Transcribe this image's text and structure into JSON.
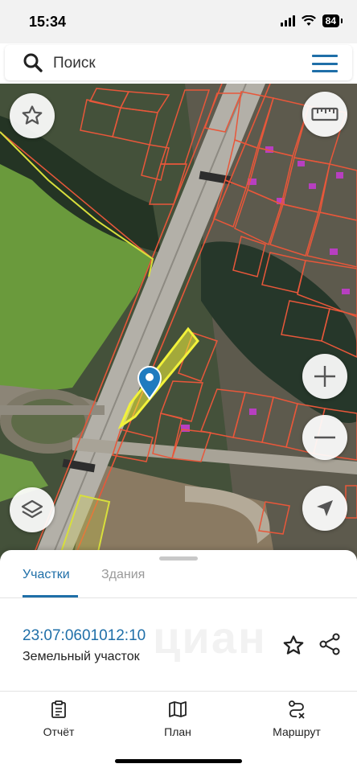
{
  "status_bar": {
    "time": "15:34",
    "battery": "84"
  },
  "search": {
    "placeholder": "Поиск"
  },
  "map": {
    "icons": {
      "favorites": "star-outline-icon",
      "ruler": "ruler-icon",
      "zoom_in": "plus-icon",
      "zoom_out": "minus-icon",
      "layers": "layers-icon",
      "locate": "navigation-arrow-icon",
      "pin": "location-pin-icon"
    },
    "colors": {
      "parcel_outline": "#e8573a",
      "selected_parcel": "#f2f23a",
      "pin": "#1f7bbf"
    }
  },
  "sheet": {
    "tabs": [
      {
        "label": "Участки",
        "active": true
      },
      {
        "label": "Здания",
        "active": false
      }
    ],
    "result": {
      "cadastral_number": "23:07:0601012:10",
      "type": "Земельный участок",
      "watermark": "циан"
    }
  },
  "bottom_nav": [
    {
      "label": "Отчёт",
      "icon": "clipboard-icon"
    },
    {
      "label": "План",
      "icon": "map-icon"
    },
    {
      "label": "Маршрут",
      "icon": "route-icon"
    }
  ],
  "colors": {
    "accent": "#1f6fa8"
  }
}
